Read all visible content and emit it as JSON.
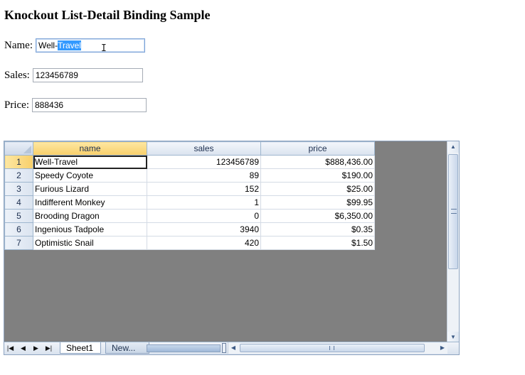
{
  "page": {
    "title": "Knockout List-Detail Binding Sample"
  },
  "form": {
    "name_label": "Name:",
    "name_value_unselected": "Well-",
    "name_value_selected": "Travel",
    "sales_label": "Sales:",
    "sales_value": "123456789",
    "price_label": "Price:",
    "price_value": "888436"
  },
  "grid": {
    "columns": [
      "name",
      "sales",
      "price"
    ],
    "active_column": "name",
    "selected_row": 1,
    "rows": [
      {
        "num": "1",
        "name": "Well-Travel",
        "sales": "123456789",
        "price": "$888,436.00"
      },
      {
        "num": "2",
        "name": "Speedy Coyote",
        "sales": "89",
        "price": "$190.00"
      },
      {
        "num": "3",
        "name": "Furious Lizard",
        "sales": "152",
        "price": "$25.00"
      },
      {
        "num": "4",
        "name": "Indifferent Monkey",
        "sales": "1",
        "price": "$99.95"
      },
      {
        "num": "5",
        "name": "Brooding Dragon",
        "sales": "0",
        "price": "$6,350.00"
      },
      {
        "num": "6",
        "name": "Ingenious Tadpole",
        "sales": "3940",
        "price": "$0.35"
      },
      {
        "num": "7",
        "name": "Optimistic Snail",
        "sales": "420",
        "price": "$1.50"
      }
    ]
  },
  "tabs": {
    "sheet1": "Sheet1",
    "new": "New..."
  },
  "icons": {
    "nav_first": "first-page-icon",
    "nav_prev": "previous-page-icon",
    "nav_next": "next-page-icon",
    "nav_last": "last-page-icon"
  },
  "colors": {
    "accent": "#3399ff",
    "header_active": "#f8cf6a",
    "sheet_bg": "#808080"
  }
}
